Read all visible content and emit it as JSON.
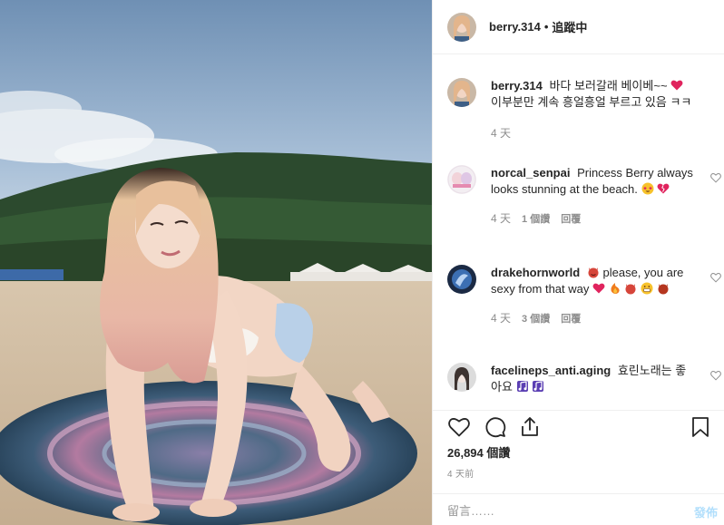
{
  "header": {
    "username": "berry.314",
    "separator": "•",
    "follow_state": "追蹤中"
  },
  "caption": {
    "username": "berry.314",
    "text": "바다 보러갈래 베이베~~",
    "text_line2": "이부분만 계속 흥얼흥얼 부르고 있음 ㅋㅋ",
    "time": "4 天"
  },
  "comments": [
    {
      "username": "norcal_senpai",
      "text": "Princess Berry always looks stunning at the beach.",
      "time": "4 天",
      "likes": "1 個讚",
      "reply": "回覆"
    },
    {
      "username": "drakehornworld",
      "text_before": "please, you are sexy from that way",
      "time": "4 天",
      "likes": "3 個讚",
      "reply": "回覆"
    },
    {
      "username": "facelineps_anti.aging",
      "text": "효린노래는 좋아요"
    }
  ],
  "stats": {
    "views": "26,894 個讚",
    "ago": "4 天前"
  },
  "add_comment": {
    "placeholder": "留言……",
    "post_label": "發佈"
  },
  "colors": {
    "primary_text": "#262626",
    "secondary_text": "#8e8e8e",
    "post_button_disabled": "#b2dffc",
    "border": "#efefef"
  },
  "icons": [
    "heart-icon",
    "comment-icon",
    "share-icon",
    "bookmark-icon",
    "heart-outline-small-icon"
  ]
}
